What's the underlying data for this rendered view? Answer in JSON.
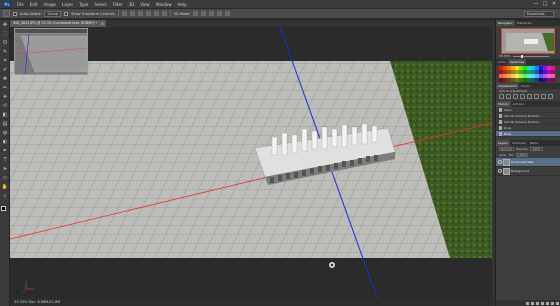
{
  "app": {
    "logo": "Ps",
    "menus": [
      "File",
      "Edit",
      "Image",
      "Layer",
      "Type",
      "Select",
      "Filter",
      "3D",
      "View",
      "Window",
      "Help"
    ],
    "window_controls": [
      "—",
      "□",
      "✕"
    ]
  },
  "options_bar": {
    "auto_select_label": "Auto-Select:",
    "auto_select_value": "Group",
    "transform_label": "Show Transform Controls",
    "mode_label": "3D Mode:",
    "workspace": "Essentials"
  },
  "document": {
    "tab_title": "IMG_5632.JPG @ 33.3% (Contoured text, RGB/8*) *",
    "tab_close": "×",
    "status": "33.33%    Doc: 8.58M/21.8M"
  },
  "tools": [
    "move-icon",
    "marquee-icon",
    "lasso-icon",
    "quick-select-icon",
    "crop-icon",
    "eyedropper-icon",
    "healing-icon",
    "brush-icon",
    "clone-stamp-icon",
    "history-brush-icon",
    "eraser-icon",
    "gradient-icon",
    "blur-icon",
    "dodge-icon",
    "pen-icon",
    "type-icon",
    "path-select-icon",
    "shape-icon",
    "hand-icon",
    "zoom-icon"
  ],
  "tool_glyphs": [
    "✥",
    "⬚",
    "ʘ",
    "✎",
    "⌗",
    "✐",
    "✚",
    "✏",
    "⎈",
    "↺",
    "◧",
    "▤",
    "◍",
    "◐",
    "✒",
    "T",
    "➤",
    "▭",
    "✋",
    "⌕"
  ],
  "panels": {
    "navigator_tabs": [
      "Navigator",
      "Histogram"
    ],
    "zoom_value": "33.33%",
    "swatches_tabs": [
      "Color",
      "Swatches"
    ],
    "adjustments_tabs": [
      "Adjustments",
      "Styles"
    ],
    "adjustments_label": "Add an adjustment",
    "history_tabs": [
      "History",
      "Actions"
    ],
    "history_items": [
      "Open",
      "Set 3D Camera Position",
      "Set 3D Camera Position",
      "Drop",
      "Drop"
    ],
    "layers_tabs": [
      "Layers",
      "Channels",
      "Paths"
    ],
    "blend_mode": "Normal",
    "opacity_label": "Opacity:",
    "opacity_value": "100%",
    "lock_label": "Lock:",
    "fill_label": "Fill:",
    "fill_value": "100%",
    "layers": [
      "Contoured text",
      "Background"
    ]
  },
  "colors": {
    "accent_selected": "#5a6e88",
    "ps_blue": "#1b3e66",
    "ground_red_axis": "#e8322e",
    "ground_blue_axis": "#1a2fd6"
  }
}
